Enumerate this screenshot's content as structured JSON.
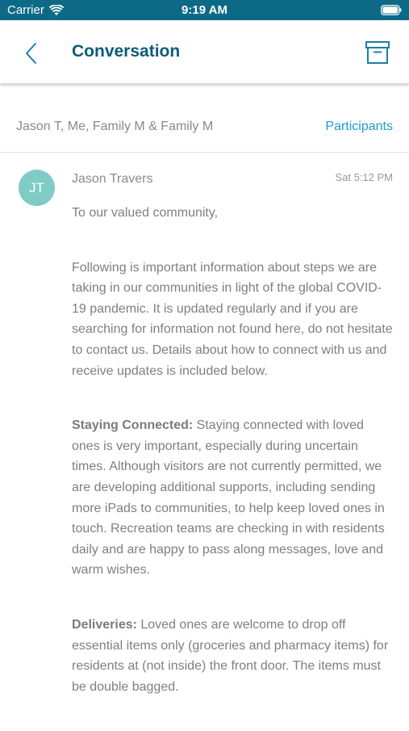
{
  "status_bar": {
    "carrier": "Carrier",
    "time": "9:19 AM",
    "icons": [
      "wifi-icon",
      "battery-icon"
    ],
    "color": "#0d6a86"
  },
  "nav": {
    "title": "Conversation",
    "back_icon": "chevron-left-icon",
    "archive_icon": "archive-box-icon"
  },
  "participants": {
    "names": "Jason T, Me, Family M & Family M",
    "link_label": "Participants",
    "link_color": "#1d9ccf"
  },
  "message": {
    "avatar_initials": "JT",
    "avatar_color": "#7fcbc6",
    "sender": "Jason Travers",
    "timestamp": "Sat 5:12 PM",
    "greeting": "To our valued community,",
    "intro": "Following is important information about steps we are taking in our communities in light of the global COVID-19 pandemic. It is updated regularly and if you are searching for information not found here, do not hesitate to contact us. Details about how to connect with us and receive updates is included below.",
    "sections": [
      {
        "heading": "Staying Connected:",
        "text": " Staying connected with loved ones is very important, especially during uncertain times. Although visitors are not currently permitted, we are developing additional supports, including sending more iPads to communities, to help keep loved ones in touch. Recreation teams are checking in with residents daily and are happy to pass along messages, love and warm wishes."
      },
      {
        "heading": "Deliveries:",
        "text": " Loved ones are welcome to drop off essential items only (groceries and pharmacy items) for residents at (not inside) the front door. The items must be double bagged."
      }
    ]
  }
}
